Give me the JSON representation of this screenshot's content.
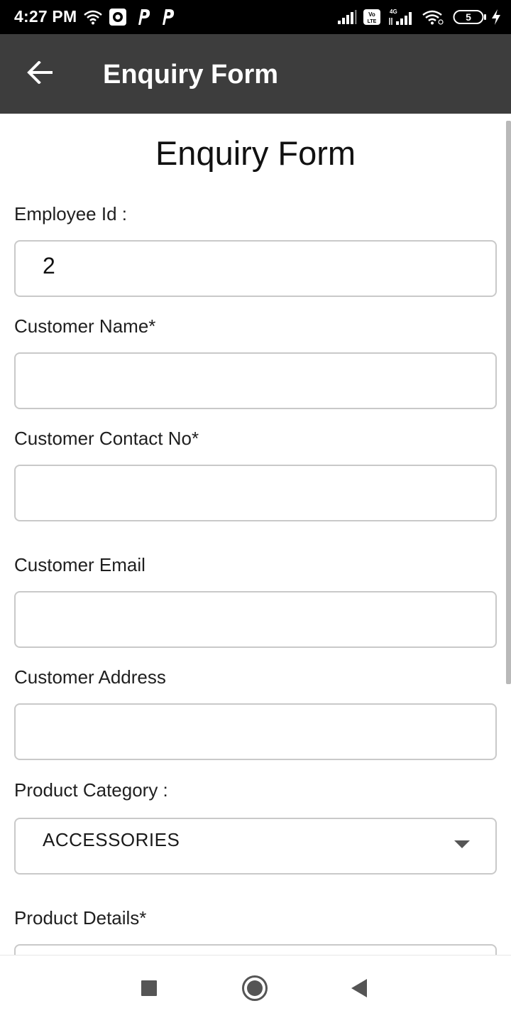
{
  "status_bar": {
    "time": "4:27 PM",
    "left_icons": [
      "wifi-icon",
      "record-icon",
      "parking-p-icon",
      "parking-p-icon"
    ],
    "right_icons": [
      "signal-icon",
      "volte-icon",
      "signal-4g-icon",
      "wifi-icon",
      "battery-icon",
      "charging-icon"
    ],
    "battery_level": "5",
    "network_label": "4G",
    "volte_label": "Vo LTE"
  },
  "app_bar": {
    "title": "Enquiry Form",
    "back_icon": "arrow-left-icon",
    "background": "#3d3d3d"
  },
  "form": {
    "heading": "Enquiry Form",
    "fields": [
      {
        "label": "Employee Id :",
        "value": "2"
      },
      {
        "label": "Customer Name*",
        "value": ""
      },
      {
        "label": "Customer Contact No*",
        "value": ""
      },
      {
        "label": "Customer Email",
        "value": ""
      },
      {
        "label": "Customer Address",
        "value": ""
      }
    ],
    "product_category": {
      "label": "Product Category :",
      "selected": "ACCESSORIES"
    },
    "product_details": {
      "label": "Product Details*",
      "value": ""
    }
  },
  "nav_bar": {
    "buttons": [
      "recents-square-icon",
      "home-circle-icon",
      "back-triangle-icon"
    ]
  }
}
